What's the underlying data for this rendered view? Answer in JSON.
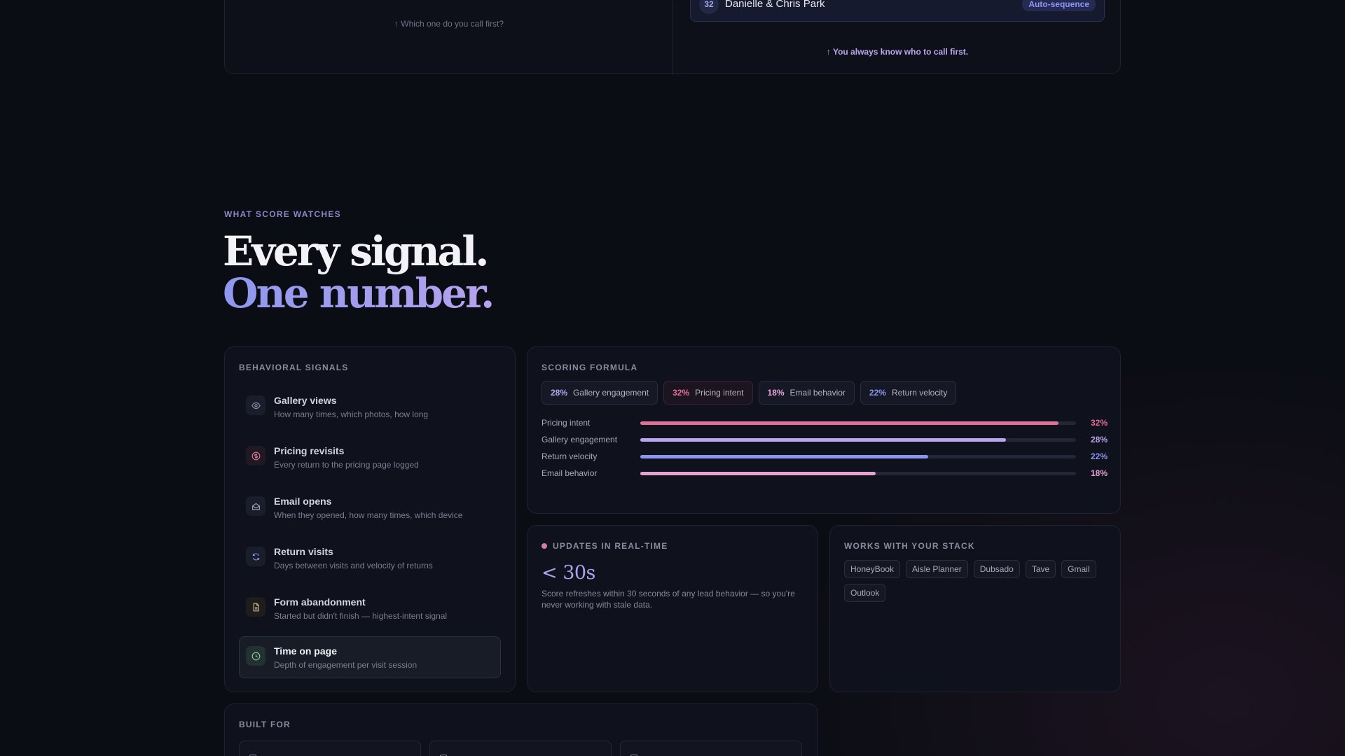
{
  "comparison": {
    "left_caption": "↑ Which one do you call first?",
    "lead": {
      "score": "32",
      "name": "Danielle & Chris Park",
      "badge": "Auto-sequence"
    },
    "right_caption": "↑ You always know who to call first."
  },
  "hero": {
    "eyebrow": "WHAT SCORE WATCHES",
    "line1": "Every signal.",
    "line2": "One number."
  },
  "signals": {
    "title": "BEHAVIORAL SIGNALS",
    "items": [
      {
        "name": "Gallery views",
        "desc": "How many times, which photos, how long",
        "icon": "eye-icon"
      },
      {
        "name": "Pricing revisits",
        "desc": "Every return to the pricing page logged",
        "icon": "dollar-icon"
      },
      {
        "name": "Email opens",
        "desc": "When they opened, how many times, which device",
        "icon": "envelope-open-icon"
      },
      {
        "name": "Return visits",
        "desc": "Days between visits and velocity of returns",
        "icon": "refresh-icon"
      },
      {
        "name": "Form abandonment",
        "desc": "Started but didn't finish — highest-intent signal",
        "icon": "document-icon"
      },
      {
        "name": "Time on page",
        "desc": "Depth of engagement per visit session",
        "icon": "clock-icon"
      }
    ]
  },
  "formula": {
    "title": "SCORING FORMULA",
    "chips": [
      {
        "pct": "28%",
        "label": "Gallery engagement",
        "color": "#b9a6ee"
      },
      {
        "pct": "32%",
        "label": "Pricing intent",
        "color": "#e46f97"
      },
      {
        "pct": "18%",
        "label": "Email behavior",
        "color": "#e5a3cf"
      },
      {
        "pct": "22%",
        "label": "Return velocity",
        "color": "#8a96ef"
      }
    ],
    "bars": [
      {
        "label": "Pricing intent",
        "value": 32,
        "display": "32%",
        "color": "#e46f97"
      },
      {
        "label": "Gallery engagement",
        "value": 28,
        "display": "28%",
        "color": "#b9a6ee"
      },
      {
        "label": "Return velocity",
        "value": 22,
        "display": "22%",
        "color": "#8a96ef"
      },
      {
        "label": "Email behavior",
        "value": 18,
        "display": "18%",
        "color": "#e5a3cf"
      }
    ]
  },
  "realtime": {
    "title": "UPDATES IN REAL-TIME",
    "metric": "< 30s",
    "desc": "Score refreshes within 30 seconds of any lead behavior — so you're never working with stale data."
  },
  "stack": {
    "title": "WORKS WITH YOUR STACK",
    "tools": [
      "HoneyBook",
      "Aisle Planner",
      "Dubsado",
      "Tave",
      "Gmail",
      "Outlook"
    ]
  },
  "built": {
    "title": "BUILT FOR"
  },
  "colors": {
    "background": "#0b0d14",
    "accent_purple": "#b9a6ee",
    "accent_pink": "#e46f97",
    "accent_blue": "#8a96ef"
  }
}
